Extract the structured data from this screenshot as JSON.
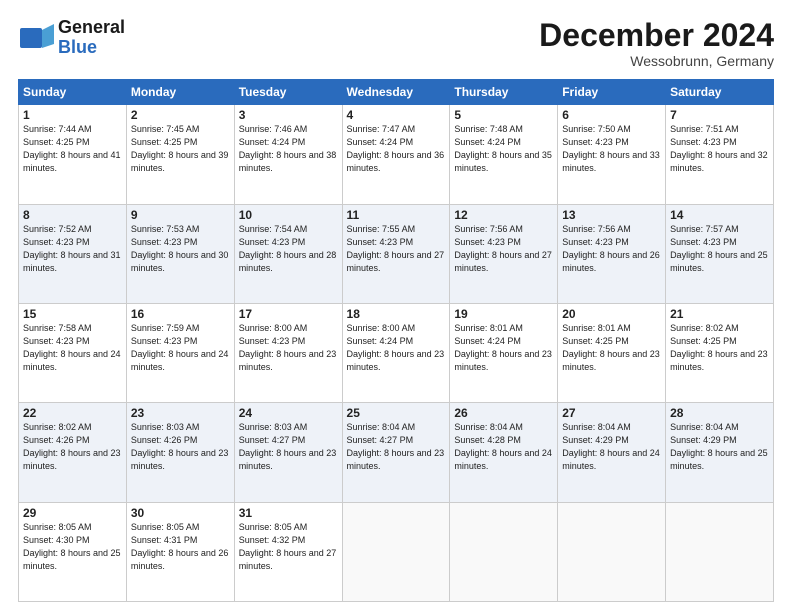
{
  "header": {
    "logo_line1": "General",
    "logo_line2": "Blue",
    "month": "December 2024",
    "location": "Wessobrunn, Germany"
  },
  "days_of_week": [
    "Sunday",
    "Monday",
    "Tuesday",
    "Wednesday",
    "Thursday",
    "Friday",
    "Saturday"
  ],
  "weeks": [
    [
      {
        "day": "1",
        "sunrise": "7:44 AM",
        "sunset": "4:25 PM",
        "daylight": "8 hours and 41 minutes."
      },
      {
        "day": "2",
        "sunrise": "7:45 AM",
        "sunset": "4:25 PM",
        "daylight": "8 hours and 39 minutes."
      },
      {
        "day": "3",
        "sunrise": "7:46 AM",
        "sunset": "4:24 PM",
        "daylight": "8 hours and 38 minutes."
      },
      {
        "day": "4",
        "sunrise": "7:47 AM",
        "sunset": "4:24 PM",
        "daylight": "8 hours and 36 minutes."
      },
      {
        "day": "5",
        "sunrise": "7:48 AM",
        "sunset": "4:24 PM",
        "daylight": "8 hours and 35 minutes."
      },
      {
        "day": "6",
        "sunrise": "7:50 AM",
        "sunset": "4:23 PM",
        "daylight": "8 hours and 33 minutes."
      },
      {
        "day": "7",
        "sunrise": "7:51 AM",
        "sunset": "4:23 PM",
        "daylight": "8 hours and 32 minutes."
      }
    ],
    [
      {
        "day": "8",
        "sunrise": "7:52 AM",
        "sunset": "4:23 PM",
        "daylight": "8 hours and 31 minutes."
      },
      {
        "day": "9",
        "sunrise": "7:53 AM",
        "sunset": "4:23 PM",
        "daylight": "8 hours and 30 minutes."
      },
      {
        "day": "10",
        "sunrise": "7:54 AM",
        "sunset": "4:23 PM",
        "daylight": "8 hours and 28 minutes."
      },
      {
        "day": "11",
        "sunrise": "7:55 AM",
        "sunset": "4:23 PM",
        "daylight": "8 hours and 27 minutes."
      },
      {
        "day": "12",
        "sunrise": "7:56 AM",
        "sunset": "4:23 PM",
        "daylight": "8 hours and 27 minutes."
      },
      {
        "day": "13",
        "sunrise": "7:56 AM",
        "sunset": "4:23 PM",
        "daylight": "8 hours and 26 minutes."
      },
      {
        "day": "14",
        "sunrise": "7:57 AM",
        "sunset": "4:23 PM",
        "daylight": "8 hours and 25 minutes."
      }
    ],
    [
      {
        "day": "15",
        "sunrise": "7:58 AM",
        "sunset": "4:23 PM",
        "daylight": "8 hours and 24 minutes."
      },
      {
        "day": "16",
        "sunrise": "7:59 AM",
        "sunset": "4:23 PM",
        "daylight": "8 hours and 24 minutes."
      },
      {
        "day": "17",
        "sunrise": "8:00 AM",
        "sunset": "4:23 PM",
        "daylight": "8 hours and 23 minutes."
      },
      {
        "day": "18",
        "sunrise": "8:00 AM",
        "sunset": "4:24 PM",
        "daylight": "8 hours and 23 minutes."
      },
      {
        "day": "19",
        "sunrise": "8:01 AM",
        "sunset": "4:24 PM",
        "daylight": "8 hours and 23 minutes."
      },
      {
        "day": "20",
        "sunrise": "8:01 AM",
        "sunset": "4:25 PM",
        "daylight": "8 hours and 23 minutes."
      },
      {
        "day": "21",
        "sunrise": "8:02 AM",
        "sunset": "4:25 PM",
        "daylight": "8 hours and 23 minutes."
      }
    ],
    [
      {
        "day": "22",
        "sunrise": "8:02 AM",
        "sunset": "4:26 PM",
        "daylight": "8 hours and 23 minutes."
      },
      {
        "day": "23",
        "sunrise": "8:03 AM",
        "sunset": "4:26 PM",
        "daylight": "8 hours and 23 minutes."
      },
      {
        "day": "24",
        "sunrise": "8:03 AM",
        "sunset": "4:27 PM",
        "daylight": "8 hours and 23 minutes."
      },
      {
        "day": "25",
        "sunrise": "8:04 AM",
        "sunset": "4:27 PM",
        "daylight": "8 hours and 23 minutes."
      },
      {
        "day": "26",
        "sunrise": "8:04 AM",
        "sunset": "4:28 PM",
        "daylight": "8 hours and 24 minutes."
      },
      {
        "day": "27",
        "sunrise": "8:04 AM",
        "sunset": "4:29 PM",
        "daylight": "8 hours and 24 minutes."
      },
      {
        "day": "28",
        "sunrise": "8:04 AM",
        "sunset": "4:29 PM",
        "daylight": "8 hours and 25 minutes."
      }
    ],
    [
      {
        "day": "29",
        "sunrise": "8:05 AM",
        "sunset": "4:30 PM",
        "daylight": "8 hours and 25 minutes."
      },
      {
        "day": "30",
        "sunrise": "8:05 AM",
        "sunset": "4:31 PM",
        "daylight": "8 hours and 26 minutes."
      },
      {
        "day": "31",
        "sunrise": "8:05 AM",
        "sunset": "4:32 PM",
        "daylight": "8 hours and 27 minutes."
      },
      null,
      null,
      null,
      null
    ]
  ]
}
